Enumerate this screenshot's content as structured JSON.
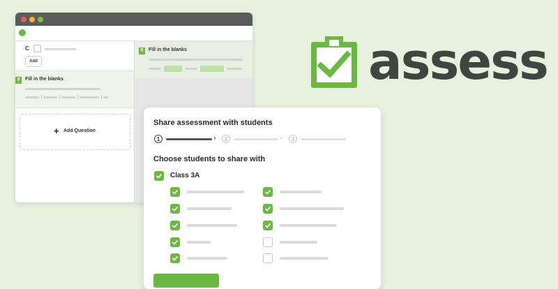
{
  "editor": {
    "option_letter": "C",
    "add_label": "Add",
    "question_number": "9",
    "question_title": "Fill in the blanks",
    "add_question_label": "Add Question"
  },
  "logo": {
    "text": "assess",
    "icon": "clipboard-check-icon",
    "color": "#6bb843",
    "text_color": "#3d4640"
  },
  "share": {
    "title": "Share assessment with students",
    "steps": [
      "1",
      "2",
      "3"
    ],
    "active_step": 1,
    "choose_label": "Choose students to share with",
    "class_name": "Class 3A",
    "class_checked": true,
    "students_left_checked": [
      true,
      true,
      true,
      true,
      true
    ],
    "students_right_checked": [
      true,
      true,
      true,
      false,
      false
    ]
  },
  "colors": {
    "accent": "#6bb843",
    "background": "#e7f1de"
  }
}
